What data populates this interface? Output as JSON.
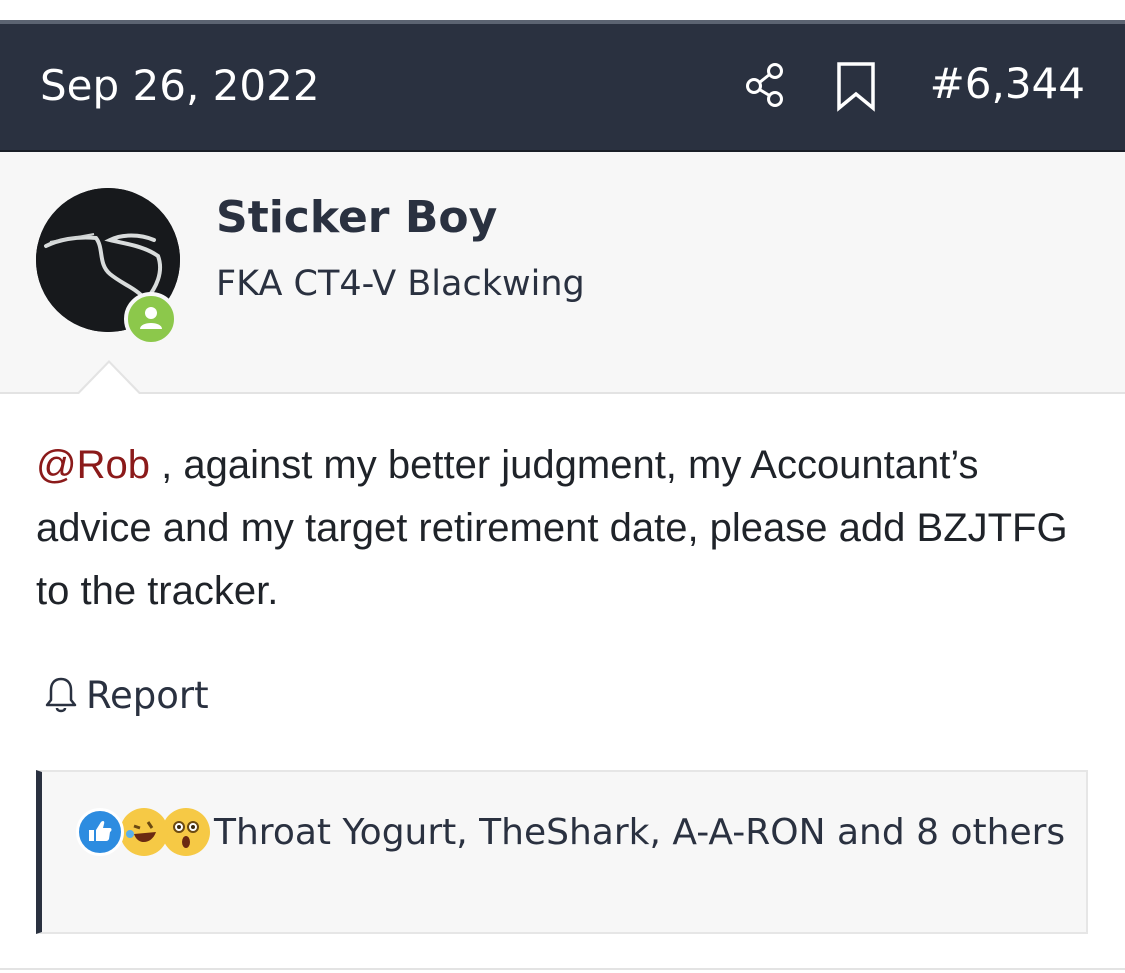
{
  "post": {
    "date": "Sep 26, 2022",
    "number": "#6,344",
    "icons": {
      "share": "share-icon",
      "bookmark": "bookmark-icon"
    }
  },
  "user": {
    "name": "Sticker Boy",
    "title": "FKA CT4-V Blackwing",
    "status": "online",
    "status_color": "#8cc84b"
  },
  "body": {
    "mention": "@Rob",
    "text": " , against my better judgment, my Accountant’s advice and my target retirement date, please add BZJTFG to the tracker."
  },
  "actions": {
    "report_label": "Report",
    "report_icon": "bell-icon"
  },
  "reactions": {
    "icons": [
      "like-icon",
      "haha-icon",
      "wow-icon"
    ],
    "summary": "Throat Yogurt, TheShark, A-A-RON and 8 others"
  },
  "colors": {
    "header_bg": "#2a3140",
    "mention": "#8b1a1a",
    "panel_bg": "#f7f7f7"
  }
}
